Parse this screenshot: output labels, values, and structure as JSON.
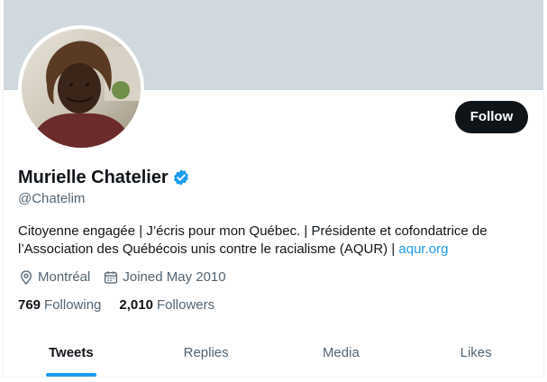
{
  "profile": {
    "display_name": "Murielle Chatelier",
    "handle": "@Chatelim",
    "verified_icon": "verified-badge-icon",
    "bio_text": "Citoyenne engagée | J’écris pour mon Québec. | Présidente et cofondatrice de l’Association des Québécois unis contre le racialisme (AQUR) | ",
    "bio_link": "aqur.org",
    "location": "Montréal",
    "joined": "Joined May 2010",
    "following_count": "769",
    "following_label": "Following",
    "followers_count": "2,010",
    "followers_label": "Followers"
  },
  "actions": {
    "follow_label": "Follow"
  },
  "tabs": [
    {
      "label": "Tweets",
      "active": true
    },
    {
      "label": "Replies",
      "active": false
    },
    {
      "label": "Media",
      "active": false
    },
    {
      "label": "Likes",
      "active": false
    }
  ],
  "colors": {
    "banner": "#cfd9de",
    "accent": "#1d9bf0",
    "primary_text": "#0f1419",
    "secondary_text": "#536471"
  }
}
